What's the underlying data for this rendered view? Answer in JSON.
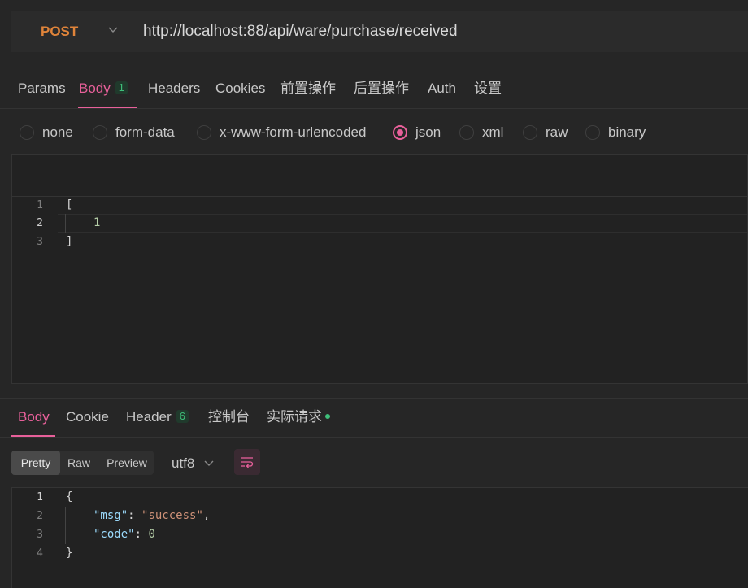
{
  "request": {
    "method": "POST",
    "url": "http://localhost:88/api/ware/purchase/received"
  },
  "request_tabs": [
    {
      "label": "Params"
    },
    {
      "label": "Body",
      "badge": "1",
      "active": true
    },
    {
      "label": "Headers"
    },
    {
      "label": "Cookies"
    },
    {
      "label": "前置操作"
    },
    {
      "label": "后置操作"
    },
    {
      "label": "Auth"
    },
    {
      "label": "设置"
    }
  ],
  "body_types": [
    {
      "label": "none"
    },
    {
      "label": "form-data"
    },
    {
      "label": "x-www-form-urlencoded"
    },
    {
      "label": "json",
      "selected": true
    },
    {
      "label": "xml"
    },
    {
      "label": "raw"
    },
    {
      "label": "binary"
    }
  ],
  "request_body": {
    "lines": [
      {
        "num": "1",
        "text": "["
      },
      {
        "num": "2",
        "text": "1"
      },
      {
        "num": "3",
        "text": "]"
      }
    ]
  },
  "response_tabs": [
    {
      "label": "Body",
      "active": true
    },
    {
      "label": "Cookie"
    },
    {
      "label": "Header",
      "badge": "6"
    },
    {
      "label": "控制台"
    },
    {
      "label": "实际请求"
    }
  ],
  "response_view": {
    "modes": [
      "Pretty",
      "Raw",
      "Preview"
    ],
    "selected_mode": "Pretty",
    "encoding": "utf8"
  },
  "response_body": {
    "line_numbers": [
      "1",
      "2",
      "3",
      "4"
    ],
    "open_brace": "{",
    "close_brace": "}",
    "fields": [
      {
        "key": "\"msg\"",
        "value": "\"success\"",
        "trailing": ","
      },
      {
        "key": "\"code\"",
        "value": "0",
        "trailing": ""
      }
    ]
  },
  "colors": {
    "accent": "#e8609a",
    "method": "#e0843a",
    "badge_green": "#3fbf7a",
    "background": "#262626"
  },
  "icons": [
    "chevron-down-icon",
    "wrap-lines-icon",
    "status-dot-icon"
  ]
}
